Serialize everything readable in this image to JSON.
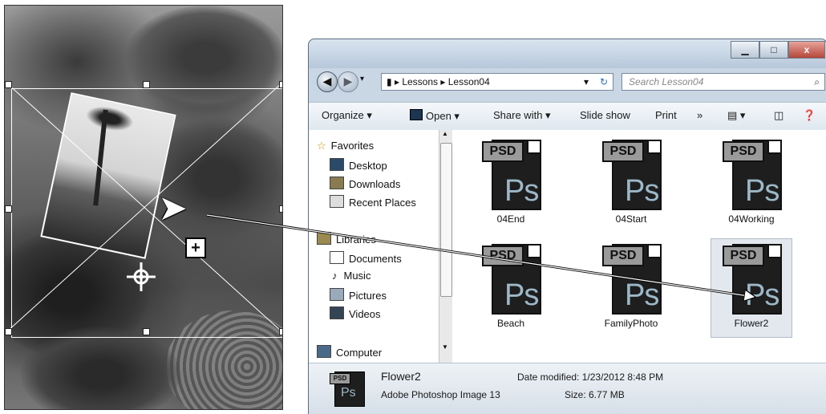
{
  "explorer": {
    "breadcrumb": [
      "Lessons",
      "Lesson04"
    ],
    "search_placeholder": "Search Lesson04",
    "toolbar": {
      "organize": "Organize ▾",
      "open": "Open ▾",
      "share_with": "Share with ▾",
      "slide_show": "Slide show",
      "print": "Print",
      "more": "»"
    },
    "nav": {
      "favorites": "Favorites",
      "desktop": "Desktop",
      "downloads": "Downloads",
      "recent_places": "Recent Places",
      "libraries": "Libraries",
      "documents": "Documents",
      "music": "Music",
      "pictures": "Pictures",
      "videos": "Videos",
      "computer": "Computer"
    },
    "files": [
      {
        "name": "04End",
        "tag": "PSD",
        "icon": "Ps"
      },
      {
        "name": "04Start",
        "tag": "PSD",
        "icon": "Ps"
      },
      {
        "name": "04Working",
        "tag": "PSD",
        "icon": "Ps"
      },
      {
        "name": "Beach",
        "tag": "PSD",
        "icon": "Ps"
      },
      {
        "name": "FamilyPhoto",
        "tag": "PSD",
        "icon": "Ps"
      },
      {
        "name": "Flower2",
        "tag": "PSD",
        "icon": "Ps",
        "selected": true
      }
    ],
    "details": {
      "name": "Flower2",
      "type": "Adobe Photoshop Image 13",
      "date_modified": "Date modified: 1/23/2012 8:48 PM",
      "size": "Size: 6.77 MB",
      "thumb_tag": "PSD",
      "thumb_icon": "Ps"
    },
    "window_buttons": {
      "minimize": "▁",
      "maximize": "□",
      "close": "x"
    }
  },
  "canvas": {
    "plus_badge": "+"
  }
}
